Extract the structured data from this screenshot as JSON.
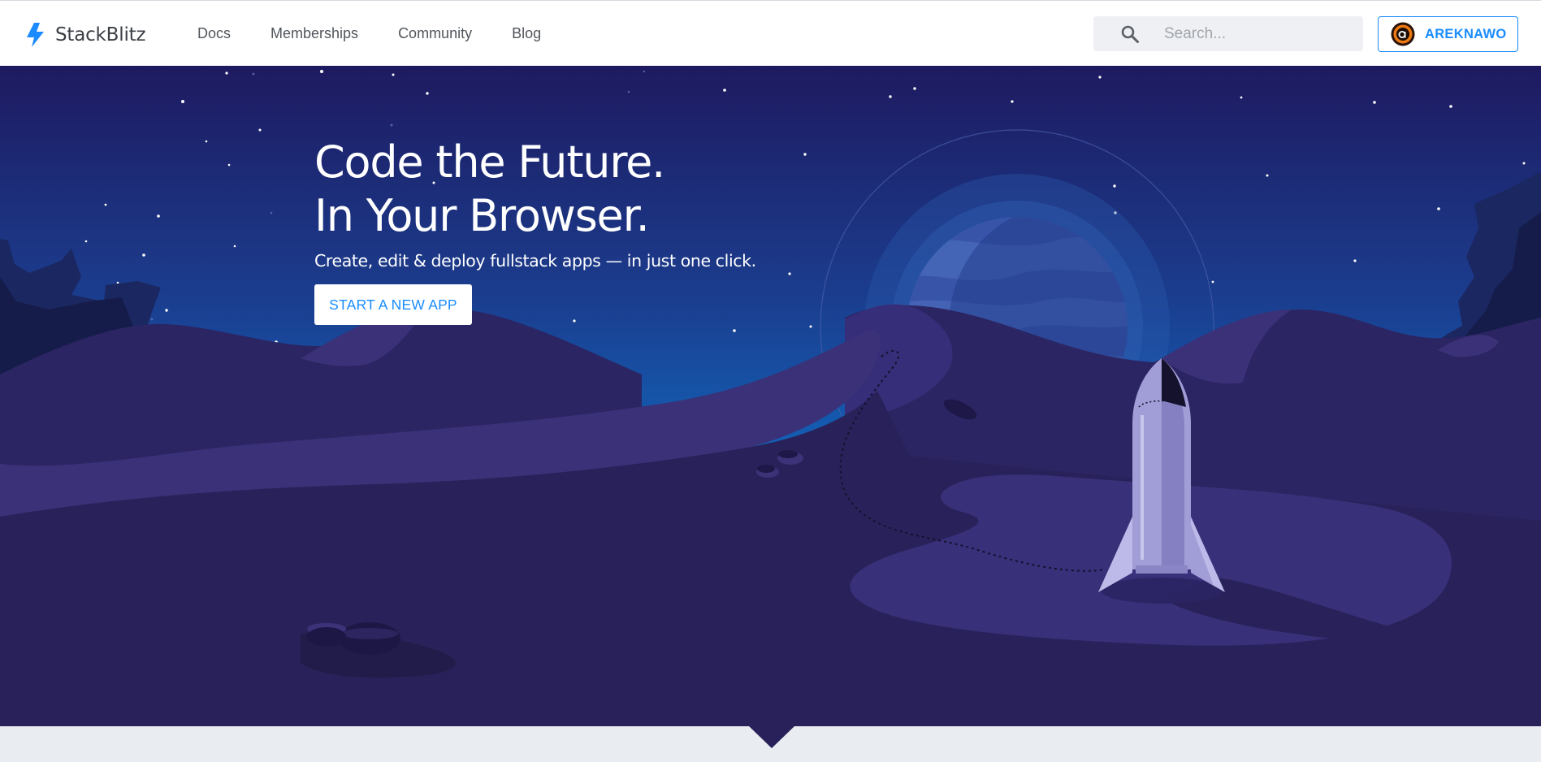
{
  "app": {
    "brand": "StackBlitz",
    "brand_color": "#1a8cff",
    "logo_icon": "lightning-bolt-icon"
  },
  "nav": {
    "items": [
      {
        "label": "Docs"
      },
      {
        "label": "Memberships"
      },
      {
        "label": "Community"
      },
      {
        "label": "Blog"
      }
    ]
  },
  "search": {
    "placeholder": "Search...",
    "value": "",
    "icon": "search-icon"
  },
  "user": {
    "name": "AREKNAWO",
    "avatar_icon": "user-avatar"
  },
  "hero": {
    "headline_line1": "Code the Future.",
    "headline_line2": "In Your Browser.",
    "subheadline": "Create, edit & deploy fullstack apps — in just one click.",
    "cta_label": "START A NEW APP",
    "illustration": "space-landscape-with-rocket"
  },
  "colors": {
    "sky_top": "#1d1b5f",
    "sky_bottom": "#1360b5",
    "ground": "#29225a",
    "cta_text": "#1a8cff",
    "footer_band": "#e9edf2"
  }
}
